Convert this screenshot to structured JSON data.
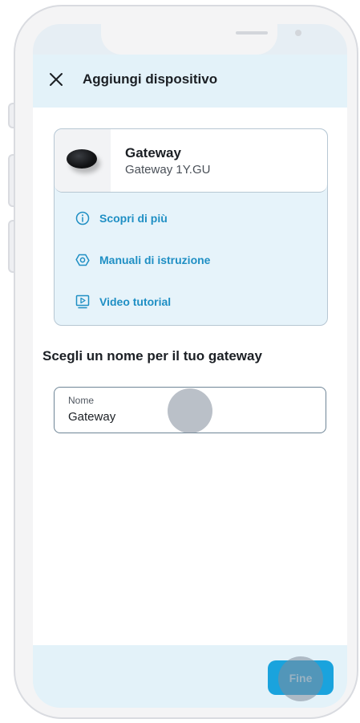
{
  "header": {
    "title": "Aggiungi dispositivo",
    "close_icon": "close-icon"
  },
  "device": {
    "name": "Gateway",
    "model": "Gateway 1Y.GU",
    "links": [
      {
        "label": "Scopri di più",
        "icon": "info-icon"
      },
      {
        "label": "Manuali di istruzione",
        "icon": "manual-hexagon-icon"
      },
      {
        "label": "Video tutorial",
        "icon": "video-play-icon"
      }
    ]
  },
  "form": {
    "section_title": "Scegli un nome per il tuo gateway",
    "name_label": "Nome",
    "name_value": "Gateway"
  },
  "footer": {
    "done_label": "Fine"
  },
  "colors": {
    "accent": "#1aa3dd",
    "link": "#1f8fc4",
    "header_bg": "#e3f2f9"
  }
}
